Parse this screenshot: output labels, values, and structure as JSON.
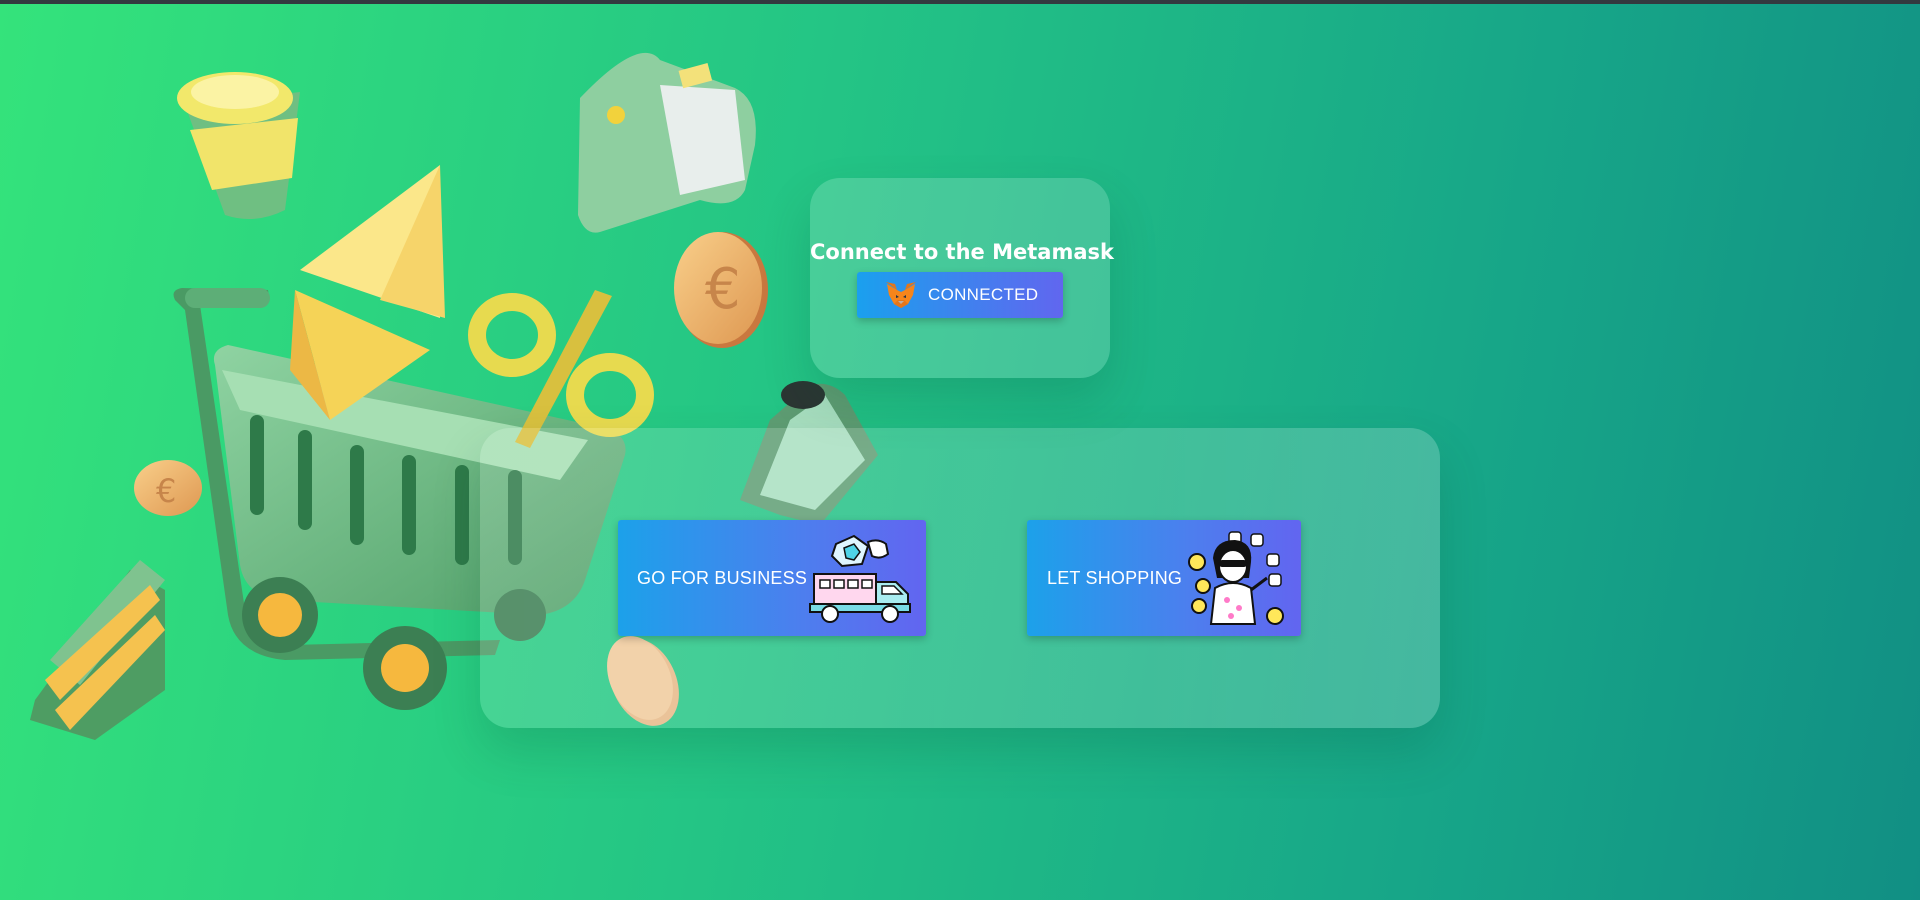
{
  "connect": {
    "title": "Connect to the Metamask",
    "status_button_label": "CONNECTED",
    "wallet_icon": "metamask-fox-icon"
  },
  "actions": {
    "business_label": "GO FOR BUSINESS",
    "shopping_label": "LET SHOPPING",
    "business_icon": "delivery-truck-illustration",
    "shopping_icon": "shopper-illustration"
  },
  "decorations": [
    "shopping-cart-illustration",
    "coffee-cup-illustration",
    "wallet-illustration",
    "ethereum-diamond-illustration",
    "percent-sign-illustration",
    "coin-illustration",
    "cash-stack-illustration",
    "phone-illustration"
  ],
  "colors": {
    "background_start": "#34e37b",
    "background_end": "#118f84",
    "button_start": "#1aa0ee",
    "button_end": "#6166ef",
    "title_text": "#ffffff"
  }
}
